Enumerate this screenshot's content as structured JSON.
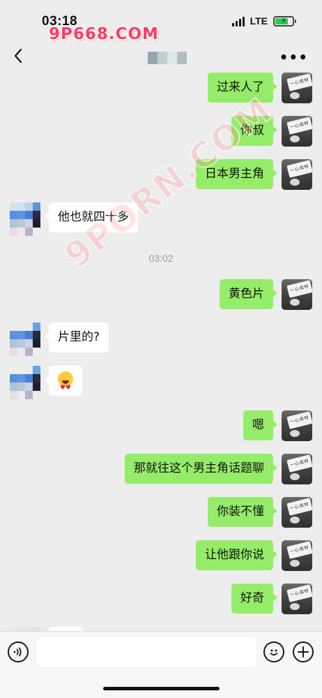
{
  "status_bar": {
    "time": "03:18",
    "network": "LTE",
    "battery_level": 0.75,
    "watermark": "9P668.COM"
  },
  "nav": {
    "title": "",
    "back_icon": "chevron-left-icon",
    "more_label": "•••"
  },
  "overlay_watermark": "9PORN.COM",
  "avatar_me_card_text": "一心成材",
  "messages": [
    {
      "sender": "me",
      "text": "过来人了"
    },
    {
      "sender": "me",
      "text": "你叔"
    },
    {
      "sender": "me",
      "text": "日本男主角"
    },
    {
      "sender": "other",
      "text": "他也就四十多"
    },
    {
      "type": "time",
      "text": "03:02"
    },
    {
      "sender": "me",
      "text": "黄色片"
    },
    {
      "sender": "other",
      "text": "片里的?"
    },
    {
      "sender": "other",
      "text": "",
      "emoji": "heart-eyes-emoji"
    },
    {
      "sender": "me",
      "text": "嗯"
    },
    {
      "sender": "me",
      "text": "那就往这个男主角话题聊"
    },
    {
      "sender": "me",
      "text": "你装不懂"
    },
    {
      "sender": "me",
      "text": "让他跟你说"
    },
    {
      "sender": "me",
      "text": "好奇"
    }
  ],
  "input_bar": {
    "placeholder": "",
    "value": "",
    "voice_icon": "voice-icon",
    "emoji_icon": "smiley-icon",
    "plus_icon": "plus-icon"
  },
  "colors": {
    "my_bubble": "#95ec69",
    "other_bubble": "#ffffff",
    "background": "#ededed"
  }
}
